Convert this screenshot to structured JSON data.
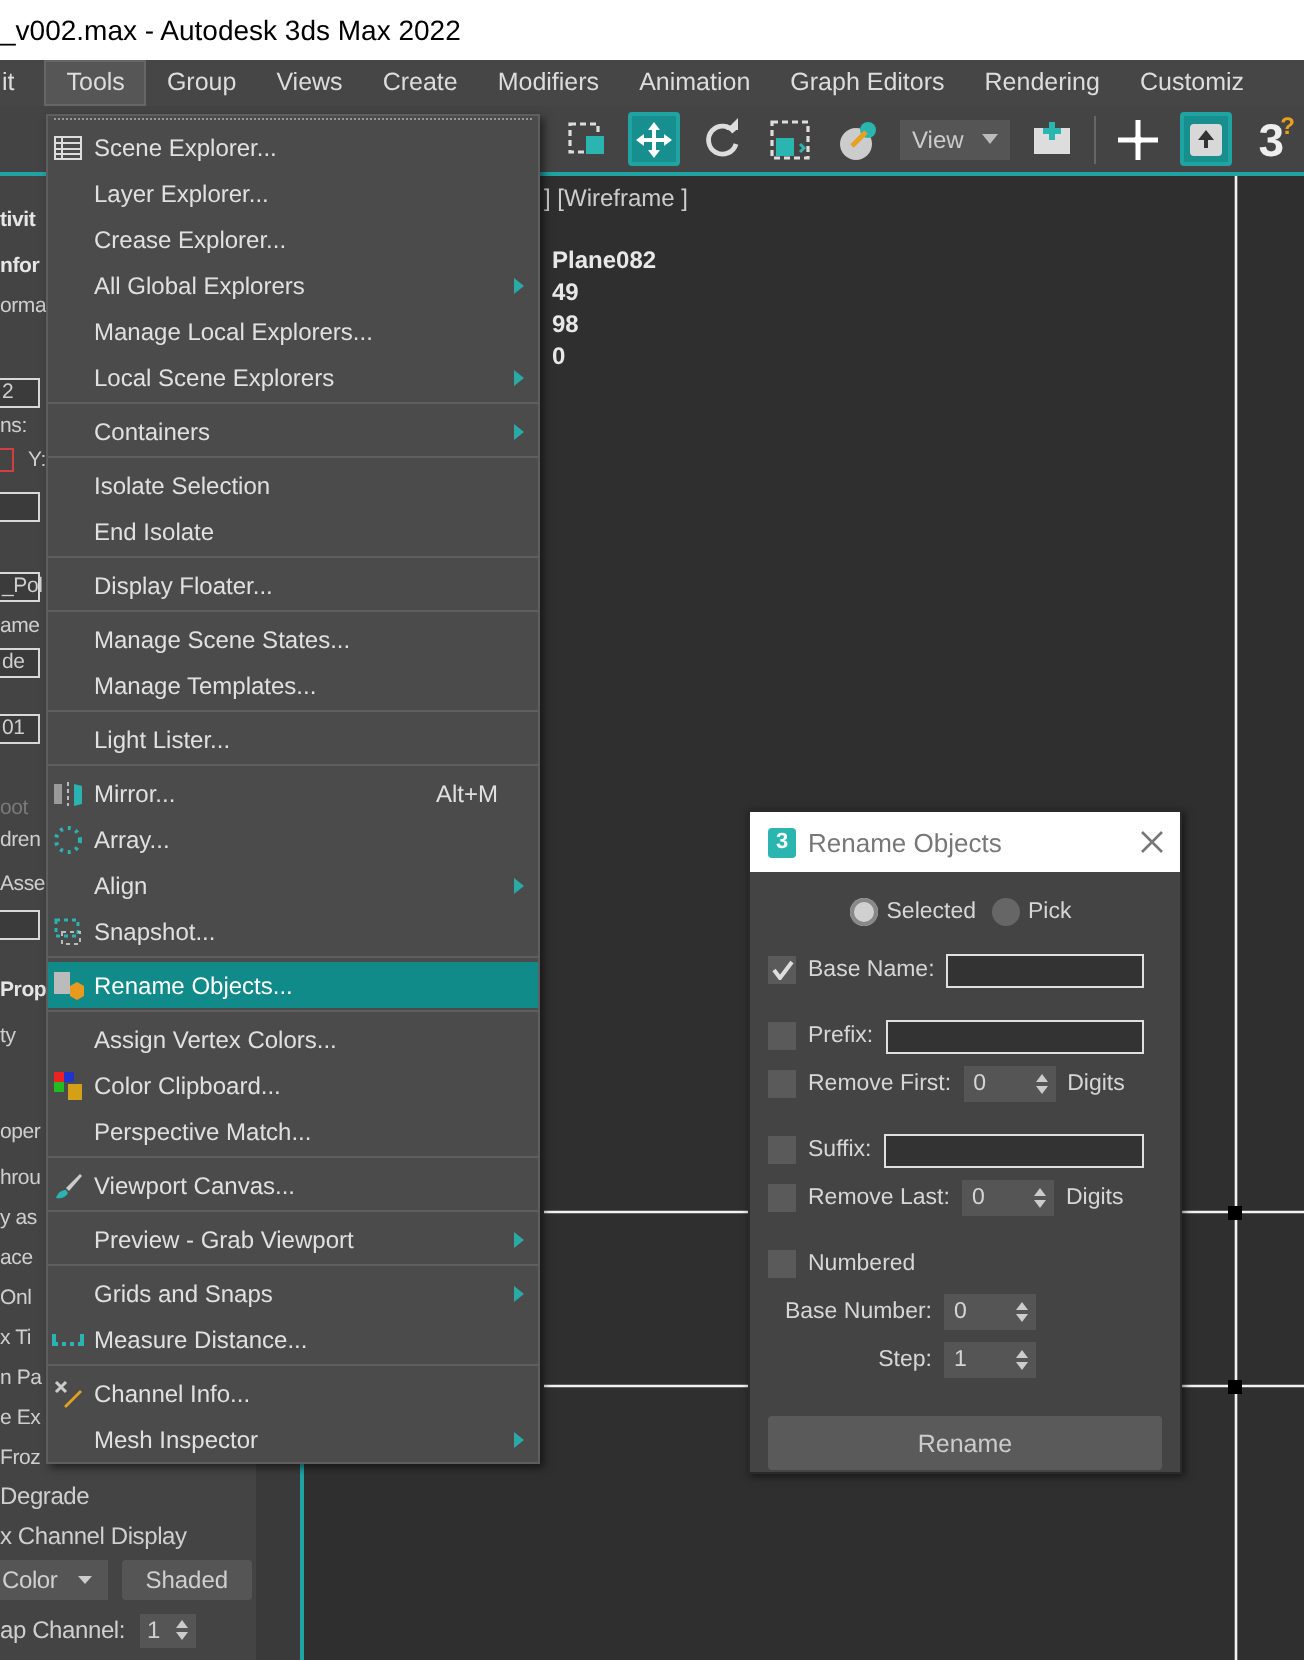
{
  "window": {
    "title": "_v002.max - Autodesk 3ds Max 2022"
  },
  "menu_bar": {
    "items": [
      {
        "label": "it",
        "selected": false
      },
      {
        "label": "Tools",
        "selected": true
      },
      {
        "label": "Group",
        "selected": false
      },
      {
        "label": "Views",
        "selected": false
      },
      {
        "label": "Create",
        "selected": false
      },
      {
        "label": "Modifiers",
        "selected": false
      },
      {
        "label": "Animation",
        "selected": false
      },
      {
        "label": "Graph Editors",
        "selected": false
      },
      {
        "label": "Rendering",
        "selected": false
      },
      {
        "label": "Customiz",
        "selected": false
      }
    ]
  },
  "toolbar": {
    "tools": [
      {
        "kind": "button",
        "selected": false
      },
      {
        "kind": "button",
        "selected": true
      },
      {
        "kind": "button",
        "selected": false
      },
      {
        "kind": "button",
        "selected": false
      },
      {
        "kind": "button",
        "selected": false
      },
      {
        "kind": "dropdown",
        "value": "View"
      },
      {
        "kind": "button",
        "selected": false
      },
      {
        "kind": "button",
        "selected": false
      },
      {
        "kind": "button",
        "selected": true
      }
    ],
    "help": {
      "main": "3",
      "mark": "?"
    }
  },
  "command_panel": {
    "rows": [
      {
        "items": [
          {
            "kind": "heading",
            "text": "tivit"
          }
        ]
      },
      {
        "items": [
          {
            "kind": "heading",
            "text": "nfor"
          }
        ]
      },
      {
        "items": [
          {
            "kind": "text",
            "text": "orma"
          }
        ]
      },
      {
        "items": [
          {
            "kind": "field",
            "text": "2"
          }
        ]
      },
      {
        "items": [
          {
            "kind": "text",
            "text": "ns:"
          }
        ]
      },
      {
        "items": [
          {
            "kind": "box"
          },
          {
            "kind": "text",
            "text": "Y:"
          }
        ]
      },
      {
        "items": [
          {
            "kind": "field"
          }
        ]
      },
      {
        "items": [
          {
            "kind": "field",
            "text": "_Pol"
          }
        ]
      },
      {
        "items": [
          {
            "kind": "text",
            "text": "ame"
          }
        ]
      },
      {
        "items": [
          {
            "kind": "field",
            "text": "de"
          }
        ]
      },
      {
        "items": [
          {
            "kind": "field",
            "text": "01"
          }
        ]
      },
      {
        "items": [
          {
            "kind": "disabled",
            "text": "oot"
          }
        ]
      },
      {
        "items": [
          {
            "kind": "text",
            "text": "dren"
          }
        ]
      },
      {
        "items": [
          {
            "kind": "text",
            "text": "Asse"
          }
        ]
      },
      {
        "items": [
          {
            "kind": "field"
          }
        ]
      },
      {
        "items": [
          {
            "kind": "heading",
            "text": "Prop"
          }
        ]
      },
      {
        "items": [
          {
            "kind": "text",
            "text": "ty"
          }
        ]
      },
      {
        "items": [
          {
            "kind": "text",
            "text": "oper"
          }
        ]
      },
      {
        "items": [
          {
            "kind": "text",
            "text": "hrou"
          }
        ]
      },
      {
        "items": [
          {
            "kind": "text",
            "text": "y as"
          }
        ]
      },
      {
        "items": [
          {
            "kind": "text",
            "text": "ace"
          }
        ]
      },
      {
        "items": [
          {
            "kind": "text",
            "text": "Onl"
          }
        ]
      },
      {
        "items": [
          {
            "kind": "text",
            "text": "x Ti"
          }
        ]
      },
      {
        "items": [
          {
            "kind": "text",
            "text": "n Pa"
          }
        ]
      },
      {
        "items": [
          {
            "kind": "text",
            "text": "e Ex"
          }
        ]
      },
      {
        "items": [
          {
            "kind": "text",
            "text": "Froz"
          }
        ]
      },
      {
        "items": [
          {
            "kind": "text",
            "text": "Degrade"
          }
        ]
      },
      {
        "items": [
          {
            "kind": "text",
            "text": "x Channel Display"
          }
        ]
      },
      {
        "items": [
          {
            "kind": "dropdown",
            "text": "Color"
          },
          {
            "kind": "button",
            "text": "Shaded"
          }
        ]
      },
      {
        "items": [
          {
            "kind": "text",
            "text": "ap Channel:"
          },
          {
            "kind": "spinner",
            "text": "1"
          }
        ]
      }
    ]
  },
  "viewport": {
    "label": "] [Wireframe ]",
    "stats": [
      "Plane082",
      "49",
      "98",
      "0"
    ]
  },
  "tools_menu": {
    "groups": [
      {
        "items": [
          {
            "label": "Scene Explorer...",
            "submenu": false,
            "selected": false
          },
          {
            "label": "Layer Explorer...",
            "submenu": false,
            "selected": false
          },
          {
            "label": "Crease Explorer...",
            "submenu": false,
            "selected": false
          },
          {
            "label": "All Global Explorers",
            "submenu": true,
            "selected": false
          },
          {
            "label": "Manage Local Explorers...",
            "submenu": false,
            "selected": false
          },
          {
            "label": "Local Scene Explorers",
            "submenu": true,
            "selected": false
          }
        ]
      },
      {
        "items": [
          {
            "label": "Containers",
            "submenu": true,
            "selected": false
          }
        ]
      },
      {
        "items": [
          {
            "label": "Isolate Selection",
            "submenu": false,
            "selected": false
          },
          {
            "label": "End Isolate",
            "submenu": false,
            "selected": false
          }
        ]
      },
      {
        "items": [
          {
            "label": "Display Floater...",
            "submenu": false,
            "selected": false
          }
        ]
      },
      {
        "items": [
          {
            "label": "Manage Scene States...",
            "submenu": false,
            "selected": false
          },
          {
            "label": "Manage Templates...",
            "submenu": false,
            "selected": false
          }
        ]
      },
      {
        "items": [
          {
            "label": "Light Lister...",
            "submenu": false,
            "selected": false
          }
        ]
      },
      {
        "items": [
          {
            "label": "Mirror...",
            "shortcut": "Alt+M",
            "submenu": false,
            "selected": false
          },
          {
            "label": "Array...",
            "submenu": false,
            "selected": false
          },
          {
            "label": "Align",
            "submenu": true,
            "selected": false
          },
          {
            "label": "Snapshot...",
            "submenu": false,
            "selected": false
          }
        ]
      },
      {
        "items": [
          {
            "label": "Rename Objects...",
            "submenu": false,
            "selected": true
          }
        ]
      },
      {
        "items": [
          {
            "label": "Assign Vertex Colors...",
            "submenu": false,
            "selected": false
          },
          {
            "label": "Color Clipboard...",
            "submenu": false,
            "selected": false
          },
          {
            "label": "Perspective Match...",
            "submenu": false,
            "selected": false
          }
        ]
      },
      {
        "items": [
          {
            "label": "Viewport Canvas...",
            "submenu": false,
            "selected": false
          }
        ]
      },
      {
        "items": [
          {
            "label": "Preview - Grab Viewport",
            "submenu": true,
            "selected": false
          }
        ]
      },
      {
        "items": [
          {
            "label": "Grids and Snaps",
            "submenu": true,
            "selected": false
          },
          {
            "label": "Measure Distance...",
            "submenu": false,
            "selected": false
          }
        ]
      },
      {
        "items": [
          {
            "label": "Channel Info...",
            "submenu": false,
            "selected": false
          },
          {
            "label": "Mesh Inspector",
            "submenu": true,
            "selected": false
          }
        ]
      }
    ]
  },
  "rename_dialog": {
    "icon_text": "3",
    "title": "Rename Objects",
    "mode_options": [
      {
        "label": "Selected",
        "selected": true
      },
      {
        "label": "Pick",
        "selected": false
      }
    ],
    "fields": [
      {
        "kind": "text",
        "label": "Base Name:",
        "checked": true
      },
      {
        "kind": "text",
        "label": "Prefix:",
        "checked": false
      },
      {
        "kind": "spinner",
        "label": "Remove First:",
        "checked": false,
        "value": "0",
        "unit": "Digits"
      },
      {
        "kind": "text",
        "label": "Suffix:",
        "checked": false
      },
      {
        "kind": "spinner",
        "label": "Remove Last:",
        "checked": false,
        "value": "0",
        "unit": "Digits"
      },
      {
        "kind": "toggle",
        "label": "Numbered",
        "checked": false
      },
      {
        "kind": "number",
        "label": "Base Number:",
        "value": "0"
      },
      {
        "kind": "number",
        "label": "Step:",
        "value": "1"
      }
    ],
    "button": "Rename"
  }
}
